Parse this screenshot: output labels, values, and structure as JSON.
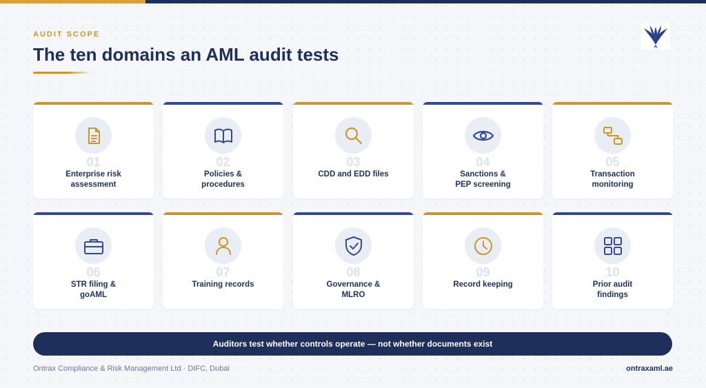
{
  "header": {
    "eyebrow": "AUDIT SCOPE",
    "title": "The ten domains an AML audit tests"
  },
  "logo": {
    "icon": "eagle-wings-logo"
  },
  "colors": {
    "navy": "#1f2f5c",
    "gold": "#c9962e",
    "card_navy_accent": "#34498f"
  },
  "domains": [
    {
      "num": "01",
      "label": "Enterprise risk\nassessment",
      "icon": "document-icon",
      "accent": "gold"
    },
    {
      "num": "02",
      "label": "Policies &\nprocedures",
      "icon": "book-icon",
      "accent": "navy"
    },
    {
      "num": "03",
      "label": "CDD and EDD files",
      "icon": "magnifier-icon",
      "accent": "gold"
    },
    {
      "num": "04",
      "label": "Sanctions &\nPEP screening",
      "icon": "eye-icon",
      "accent": "navy"
    },
    {
      "num": "05",
      "label": "Transaction\nmonitoring",
      "icon": "flow-icon",
      "accent": "gold"
    },
    {
      "num": "06",
      "label": "STR filing &\ngoAML",
      "icon": "briefcase-icon",
      "accent": "navy"
    },
    {
      "num": "07",
      "label": "Training records",
      "icon": "person-icon",
      "accent": "gold"
    },
    {
      "num": "08",
      "label": "Governance &\nMLRO",
      "icon": "shield-check-icon",
      "accent": "navy"
    },
    {
      "num": "09",
      "label": "Record keeping",
      "icon": "clock-icon",
      "accent": "gold"
    },
    {
      "num": "10",
      "label": "Prior audit\nfindings",
      "icon": "grid-icon",
      "accent": "navy"
    }
  ],
  "banner": {
    "text": "Auditors test whether controls operate — not whether documents exist"
  },
  "footer": {
    "left": "Ontrax Compliance & Risk Management Ltd · DIFC, Dubai",
    "right": "ontraxaml.ae"
  }
}
